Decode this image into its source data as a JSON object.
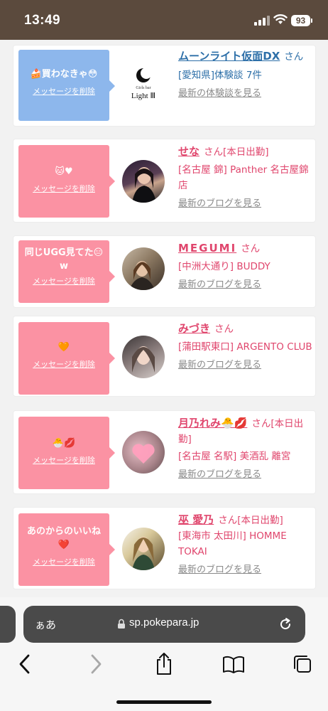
{
  "status_bar": {
    "time": "13:49",
    "battery": "93"
  },
  "items": [
    {
      "message": "🍰買わなきゃ😳",
      "delete_label": "メッセージを削除",
      "name": "ムーンライト仮面DX",
      "suffix": "さん",
      "detail": "[愛知県]体験談 7件",
      "latest": "最新の体験談を見る",
      "avatar_logo_sub": "Girls bar",
      "avatar_logo": "Light Ⅲ",
      "theme": "blue"
    },
    {
      "message": "🐱♥",
      "delete_label": "メッセージを削除",
      "name": "せな",
      "suffix": "さん[本日出勤]",
      "detail": "[名古屋 錦] Panther 名古屋錦店",
      "latest": "最新のブログを見る",
      "theme": "pink"
    },
    {
      "message": "同じUGG見てた😑w",
      "delete_label": "メッセージを削除",
      "name": "MEGUMI",
      "suffix": "さん",
      "detail": "[中洲大通り] BUDDY",
      "latest": "最新のブログを見る",
      "theme": "pink"
    },
    {
      "message": "🧡",
      "delete_label": "メッセージを削除",
      "name": "みづき",
      "suffix": "さん",
      "detail": "[蒲田駅東口] ARGENTO CLUB",
      "latest": "最新のブログを見る",
      "theme": "pink"
    },
    {
      "message": "🐣💋",
      "delete_label": "メッセージを削除",
      "name": "月乃れみ🐣💋",
      "suffix": "さん[本日出勤]",
      "detail": "[名古屋 名駅] 美酒乱 離宮",
      "latest": "最新のブログを見る",
      "theme": "pink"
    },
    {
      "message": "あのからのいいね❤️",
      "delete_label": "メッセージを削除",
      "name": "巫 愛乃",
      "suffix": "さん[本日出勤]",
      "detail": "[東海市 太田川] HOMME TOKAI",
      "latest": "最新のブログを見る",
      "theme": "pink"
    }
  ],
  "browser": {
    "text_size": "ぁあ",
    "url": "sp.pokepara.jp"
  },
  "icons": [
    "signal-icon",
    "wifi-icon",
    "battery-icon",
    "lock-icon",
    "reload-icon",
    "back-icon",
    "forward-icon",
    "share-icon",
    "bookmarks-icon",
    "tabs-icon"
  ]
}
